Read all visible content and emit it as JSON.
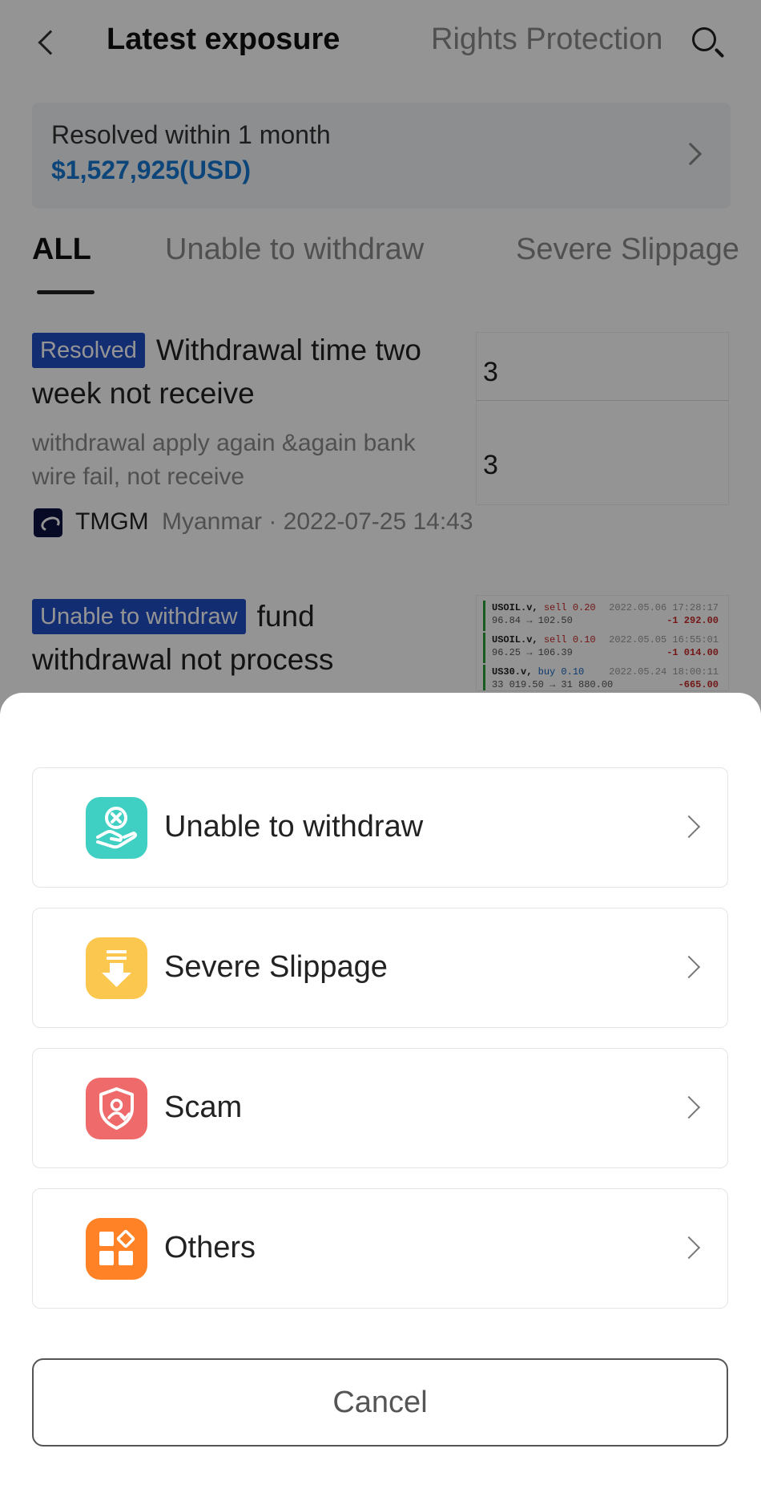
{
  "header": {
    "title": "Latest exposure",
    "secondary_tab": "Rights Protection"
  },
  "resolved_summary": {
    "label": "Resolved within 1 month",
    "amount": "$1,527,925(USD)"
  },
  "filter_tabs": [
    {
      "label": "ALL",
      "active": true
    },
    {
      "label": "Unable to withdraw",
      "active": false
    },
    {
      "label": "Severe Slippage",
      "active": false
    }
  ],
  "posts": [
    {
      "badge": "Resolved",
      "title": "Withdrawal time two week not receive",
      "description": "withdrawal apply again &again bank wire  fail, not receive",
      "broker": "TMGM",
      "meta": "Myanmar · 2022-07-25 14:43",
      "thumbnail_digits": [
        "3",
        "3"
      ]
    },
    {
      "badge": "Unable to withdraw",
      "title": "fund withdrawal not process",
      "thumbnail_rows": [
        {
          "symbol": "USOIL.v,",
          "side": "sell 0.20",
          "prices": "96.84 → 102.50",
          "date": "2022.05.06 17:28:17",
          "pl": "-1 292.00"
        },
        {
          "symbol": "USOIL.v,",
          "side": "sell 0.10",
          "prices": "96.25 → 106.39",
          "date": "2022.05.05 16:55:01",
          "pl": "-1 014.00"
        },
        {
          "symbol": "US30.v,",
          "side": "buy 0.10",
          "prices": "33 019.50 → 31 880.00",
          "date": "2022.05.24 18:00:11",
          "pl": "-665.00"
        }
      ]
    }
  ],
  "sheet": {
    "options": [
      {
        "label": "Unable to withdraw",
        "icon": "hand-x-icon",
        "color": "#3fcfc3"
      },
      {
        "label": "Severe Slippage",
        "icon": "slippage-down-icon",
        "color": "#fcc74e"
      },
      {
        "label": "Scam",
        "icon": "shield-user-icon",
        "color": "#ef6a6a"
      },
      {
        "label": "Others",
        "icon": "apps-grid-icon",
        "color": "#ff8226"
      }
    ],
    "cancel_label": "Cancel"
  }
}
